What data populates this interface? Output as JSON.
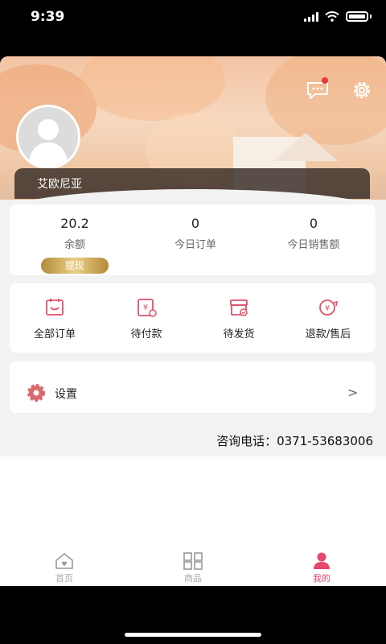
{
  "status_bar": {
    "time": "9:39"
  },
  "profile": {
    "name": "艾欧尼亚"
  },
  "stats": [
    {
      "value": "20.2",
      "label": "余额"
    },
    {
      "value": "0",
      "label": "今日订单"
    },
    {
      "value": "0",
      "label": "今日销售额"
    }
  ],
  "withdraw_label": "提现",
  "orders": [
    {
      "label": "全部订单",
      "icon": "all-orders-icon"
    },
    {
      "label": "待付款",
      "icon": "pending-payment-icon"
    },
    {
      "label": "待发货",
      "icon": "pending-shipment-icon"
    },
    {
      "label": "退款/售后",
      "icon": "refund-icon"
    }
  ],
  "settings": {
    "label": "设置",
    "chevron": ">"
  },
  "contact": {
    "phone_text": "咨询电话：0371-53683006"
  },
  "tabbar": [
    {
      "label": "首页",
      "icon": "home-icon"
    },
    {
      "label": "商品",
      "icon": "grid-icon"
    },
    {
      "label": "我的",
      "icon": "profile-icon"
    }
  ],
  "colors": {
    "accent": "#e6476a",
    "icon_red": "#e0506a",
    "gold": "#c9a456"
  }
}
